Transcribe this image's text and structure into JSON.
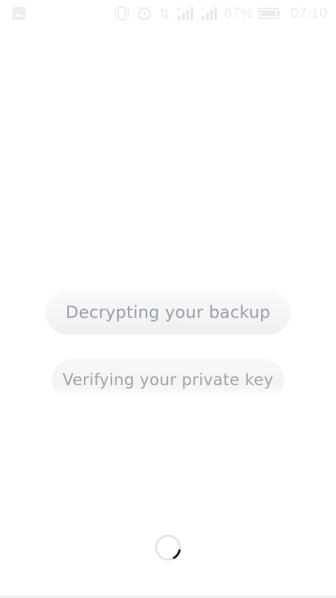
{
  "status_bar": {
    "battery_percent": "87%",
    "time": "07:10",
    "icons": [
      "gallery-icon",
      "vibrate-icon",
      "alarm-icon",
      "data-arrows-icon",
      "signal-icon",
      "signal-icon",
      "battery-icon"
    ]
  },
  "steps": [
    {
      "label": "Decrypting your backup"
    },
    {
      "label": "Verifying your private key"
    }
  ],
  "loading": {
    "icon": "spinner-icon"
  },
  "colors": {
    "pill_text": "#9aa0a9",
    "pill_bg": "#f3f4f5",
    "spinner_track": "#e3e3e3",
    "spinner_arc": "#1e1e1e"
  }
}
